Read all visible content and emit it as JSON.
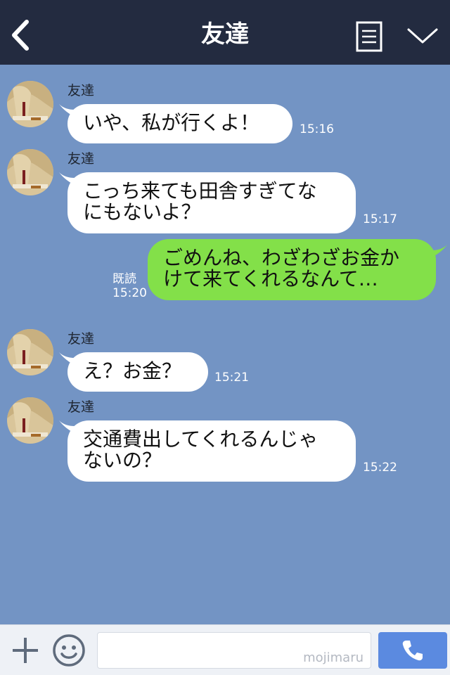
{
  "header": {
    "title": "友達",
    "back_icon": "chevron-left-icon",
    "notes_icon": "note-icon",
    "menu_icon": "chevron-down-icon",
    "background": "#232b40"
  },
  "chat": {
    "background": "#7394c4",
    "messages": [
      {
        "from": "friend",
        "sender": "友達",
        "text": "いや、私が行くよ！",
        "time": "15:16"
      },
      {
        "from": "friend",
        "sender": "友達",
        "text": "こっち来ても田舎すぎてな\nにもないよ？",
        "time": "15:17"
      },
      {
        "from": "me",
        "read": "既読",
        "text": "ごめんね、わざわざお金か\nけて来てくれるなんて…",
        "time": "15:20"
      },
      {
        "from": "friend",
        "sender": "友達",
        "text": "え？お金？",
        "time": "15:21"
      },
      {
        "from": "friend",
        "sender": "友達",
        "text": "交通費出してくれるんじゃ\nないの？",
        "time": "15:22"
      }
    ],
    "colors": {
      "friend_bubble": "#ffffff",
      "my_bubble": "#83e049"
    }
  },
  "footer": {
    "plus_icon": "plus-icon",
    "emoji_icon": "smiley-icon",
    "input_value": "",
    "watermark": "mojimaru",
    "call_icon": "phone-icon",
    "call_button_color": "#5b8ae0"
  }
}
